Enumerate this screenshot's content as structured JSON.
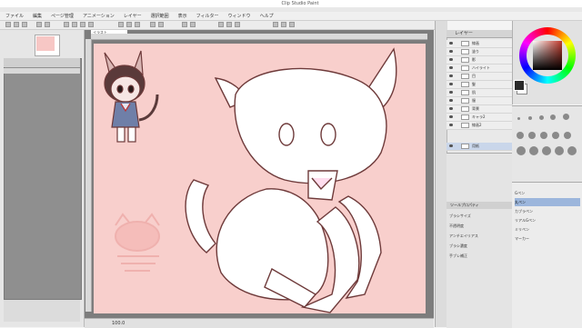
{
  "window": {
    "title": "Clip Studio Paint"
  },
  "menu": [
    "ファイル",
    "編集",
    "ページ管理",
    "アニメーション",
    "レイヤー",
    "選択範囲",
    "表示",
    "フィルター",
    "ウィンドウ",
    "ヘルプ"
  ],
  "document": {
    "tab_label": "イラスト"
  },
  "status": {
    "zoom": "100.0"
  },
  "layers": {
    "title": "レイヤー",
    "items": [
      "線画",
      "塗り",
      "影",
      "ハイライト",
      "目",
      "髪",
      "肌",
      "服",
      "背景",
      "キャラ2",
      "線画2",
      "用紙"
    ]
  },
  "tool_properties": {
    "title": "ツールプロパティ",
    "rows": [
      "ブラシサイズ",
      "不透明度",
      "アンチエイリアス",
      "ブラシ濃度",
      "手ブレ補正"
    ]
  },
  "sub_tools": {
    "items": [
      "Gペン",
      "丸ペン",
      "カブラペン",
      "リアルGペン",
      "ミリペン",
      "マーカー"
    ],
    "selected_index": 1
  },
  "colors": {
    "canvas_bg": "#f8cfcc",
    "line": "#6e3a3a",
    "accent": "#9cb6dc"
  }
}
